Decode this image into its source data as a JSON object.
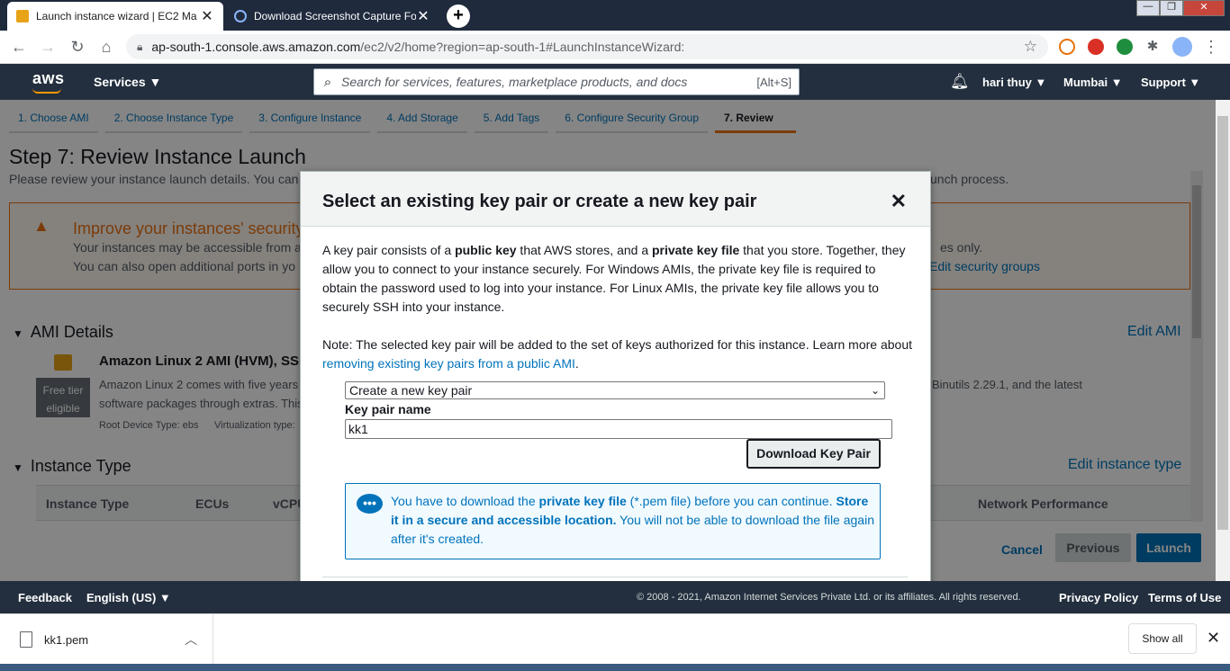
{
  "browser": {
    "tabs": [
      {
        "title": "Launch instance wizard | EC2 Ma",
        "active": true
      },
      {
        "title": "Download Screenshot Capture Fo",
        "active": false
      }
    ],
    "new_tab": "+",
    "close": "✕",
    "url_host": "ap-south-1.console.aws.amazon.com",
    "url_path": "/ec2/v2/home?region=ap-south-1#LaunchInstanceWizard:"
  },
  "aws": {
    "logo": "aws",
    "services": "Services ▼",
    "search_placeholder": "Search for services, features, marketplace products, and docs",
    "search_shortcut": "[Alt+S]",
    "user": "hari thuy ▼",
    "region": "Mumbai ▼",
    "support": "Support ▼"
  },
  "wizard": {
    "steps": [
      "1. Choose AMI",
      "2. Choose Instance Type",
      "3. Configure Instance",
      "4. Add Storage",
      "5. Add Tags",
      "6. Configure Security Group",
      "7. Review"
    ],
    "title": "Step 7: Review Instance Launch",
    "subtitle": "Please review your instance launch details. You can",
    "subtitle_right": "unch process.",
    "warning_title": "Improve your instances' security",
    "warning_l1": "Your instances may be accessible from a",
    "warning_l1_right": "es only.",
    "warning_l2": "You can also open additional ports in yo",
    "warning_link": "Edit security groups",
    "ami_section": "AMI Details",
    "edit_ami": "Edit AMI",
    "ami_title": "Amazon Linux 2 AMI (HVM), SS",
    "free_tier": "Free tier eligible",
    "ami_desc1": "Amazon Linux 2 comes with five years",
    "ami_desc1_right": "Binutils 2.29.1, and the latest",
    "ami_desc2": "software packages through extras. This",
    "ami_meta1": "Root Device Type: ebs",
    "ami_meta2": "Virtualization type:",
    "instance_section": "Instance Type",
    "edit_instance": "Edit instance type",
    "table_headers": [
      "Instance Type",
      "ECUs",
      "vCPU",
      "Network Performance"
    ],
    "cancel": "Cancel",
    "previous": "Previous",
    "launch": "Launch"
  },
  "modal": {
    "title": "Select an existing key pair or create a new key pair",
    "close": "✕",
    "para_a": "A key pair consists of a ",
    "para_b": "public key",
    "para_c": " that AWS stores, and a ",
    "para_d": "private key file",
    "para_e": " that you store. Together, they allow you to connect to your instance securely. For Windows AMIs, the private key file is required to obtain the password used to log into your instance. For Linux AMIs, the private key file allows you to securely SSH into your instance.",
    "note_a": "Note: The selected key pair will be added to the set of keys authorized for this instance. Learn more about ",
    "note_link": "removing existing key pairs from a public AMI",
    "note_end": ".",
    "select_value": "Create a new key pair",
    "key_label": "Key pair name",
    "key_value": "kk1",
    "download_btn": "Download Key Pair",
    "info_a": "You have to download the ",
    "info_b": "private key file",
    "info_c": " (*.pem file) before you can continue. ",
    "info_d": "Store it in a secure and accessible location.",
    "info_e": " You will not be able to download the file again after it's created."
  },
  "footer": {
    "feedback": "Feedback",
    "language": "English (US) ▼",
    "copyright": "© 2008 - 2021, Amazon Internet Services Private Ltd. or its affiliates. All rights reserved.",
    "privacy": "Privacy Policy",
    "terms": "Terms of Use"
  },
  "downloads": {
    "file": "kk1.pem",
    "show_all": "Show all"
  }
}
